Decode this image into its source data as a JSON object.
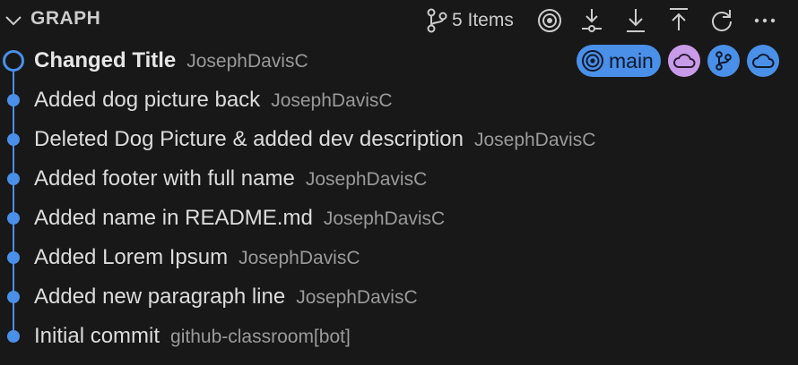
{
  "panel": {
    "title": "GRAPH",
    "items_count": "5 Items"
  },
  "toolbar": {
    "icons": [
      "source-control-icon",
      "go-to-current-icon",
      "fetch-icon",
      "pull-icon",
      "push-icon",
      "refresh-icon",
      "more-actions-icon"
    ]
  },
  "colors": {
    "accent": "#4a8fe8",
    "remote_badge": "#c89be8",
    "background": "#181818"
  },
  "commits": [
    {
      "message": "Changed Title",
      "author": "JosephDavisC",
      "is_head": true
    },
    {
      "message": "Added dog picture back",
      "author": "JosephDavisC",
      "is_head": false
    },
    {
      "message": "Deleted Dog Picture & added dev description",
      "author": "JosephDavisC",
      "is_head": false
    },
    {
      "message": "Added footer with full name",
      "author": "JosephDavisC",
      "is_head": false
    },
    {
      "message": "Added name in README.md",
      "author": "JosephDavisC",
      "is_head": false
    },
    {
      "message": "Added Lorem Ipsum",
      "author": "JosephDavisC",
      "is_head": false
    },
    {
      "message": "Added new paragraph line",
      "author": "JosephDavisC",
      "is_head": false
    },
    {
      "message": "Initial commit",
      "author": "github-classroom[bot]",
      "is_head": false
    }
  ],
  "head_badges": {
    "branch_label": "main",
    "icons": [
      "target-icon",
      "cloud-icon",
      "branch-icon",
      "cloud-icon"
    ]
  }
}
